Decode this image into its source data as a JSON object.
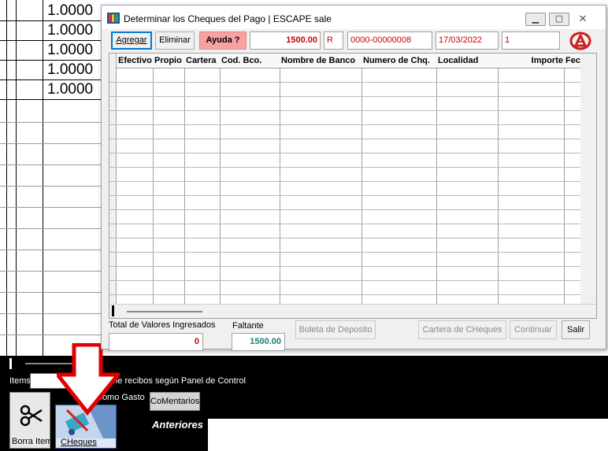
{
  "background": {
    "values": [
      "1.0000",
      "1.0000",
      "1.0000",
      "1.0000",
      "1.0000"
    ],
    "items_label": "Items",
    "print_text": "rime recibos según Panel de Control",
    "gasto_text": "Como Gasto",
    "comentarios_label": "CoMentarios",
    "anteriores_label": "Anteriores",
    "borra_label": "Borra Item",
    "cheques_label": "CHeques"
  },
  "dialog": {
    "title": "Determinar los Cheques del Pago | ESCAPE sale",
    "toolbar": {
      "agregar_label": "Agregar",
      "eliminar_label": "Eliminar",
      "ayuda_label": "Ayuda ?",
      "monto": "1500.00",
      "tipo": "R",
      "numero": "0000-00000008",
      "fecha": "17/03/2022",
      "cuenta": "1"
    },
    "grid": {
      "columns": [
        "Efectivo",
        "Propio",
        "Cartera",
        "Cod. Bco.",
        "Nombre de Banco",
        "Numero de Chq.",
        "Localidad",
        "Importe",
        "Fech"
      ],
      "rows": []
    },
    "footer": {
      "total_label": "Total de Valores Ingresados",
      "total_value": "0",
      "faltante_label": "Faltante",
      "faltante_value": "1500.00",
      "boleta_label": "Boleta de Deposito",
      "cartera_label": "Cartera de CHeques",
      "continuar_label": "Continuar",
      "salir_label": "Salir"
    }
  },
  "colors": {
    "ayuda_bg": "#f7a1a1",
    "field_text": "#cc0000",
    "faltante_text": "#1a7a7a",
    "arrow": "#e00000"
  }
}
